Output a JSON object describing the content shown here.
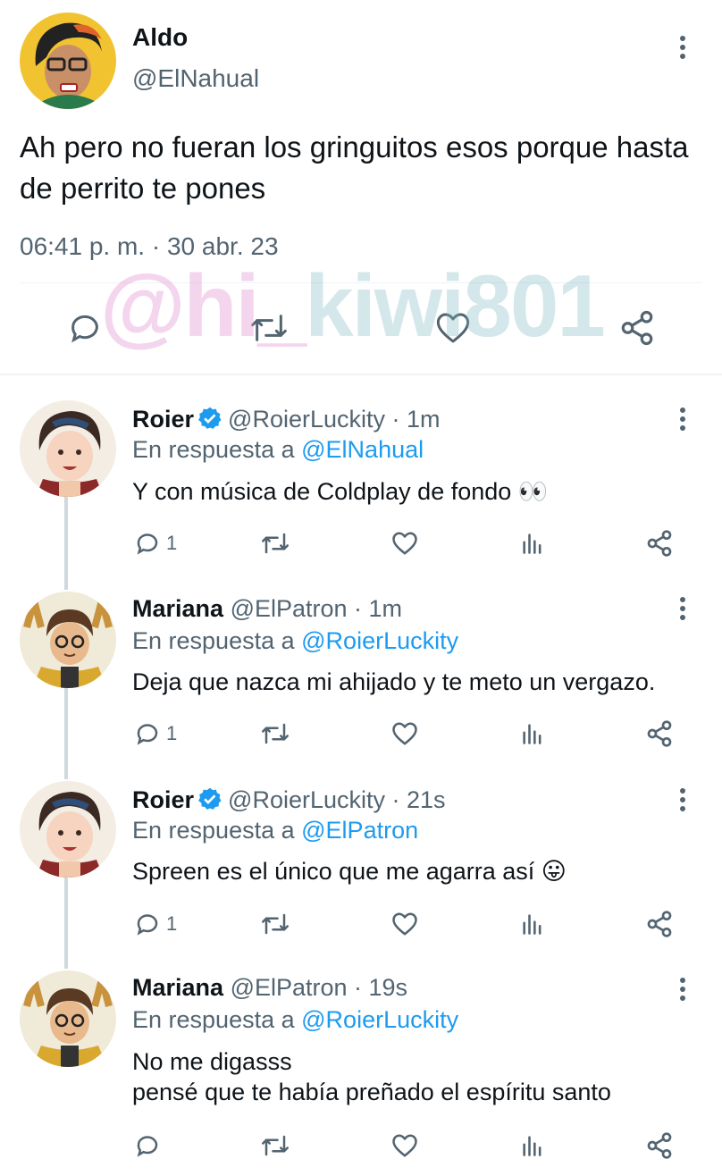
{
  "main_tweet": {
    "name": "Aldo",
    "handle": "@ElNahual",
    "text": "Ah pero no fueran los gringuitos esos porque hasta de perrito te pones",
    "timestamp": "06:41 p. m. · 30 abr. 23",
    "actions": [
      "comment-icon",
      "retweet-icon",
      "like-icon",
      "share-icon"
    ]
  },
  "watermark": {
    "part1": "@hi_",
    "part2": "kiwi801"
  },
  "replies": [
    {
      "name": "Roier",
      "verified": true,
      "handle_time": "@RoierLuckity · 1m",
      "replying_label": "En respuesta a",
      "replying_to": "@ElNahual",
      "text": "Y con música de Coldplay de fondo 👀",
      "reply_count": "1"
    },
    {
      "name": "Mariana",
      "verified": false,
      "handle_time": "@ElPatron · 1m",
      "replying_label": "En respuesta a",
      "replying_to": "@RoierLuckity",
      "text": "Deja que nazca mi ahijado y te meto un vergazo.",
      "reply_count": "1"
    },
    {
      "name": "Roier",
      "verified": true,
      "handle_time": "@RoierLuckity · 21s",
      "replying_label": "En respuesta a",
      "replying_to": "@ElPatron",
      "text": "Spreen es el único que me agarra así 😛",
      "reply_count": "1"
    },
    {
      "name": "Mariana",
      "verified": false,
      "handle_time": "@ElPatron · 19s",
      "replying_label": "En respuesta a",
      "replying_to": "@RoierLuckity",
      "text_line1": "No me digasss",
      "text_line2": "pensé que te había preñado el espíritu santo",
      "reply_count": ""
    }
  ],
  "colors": {
    "text": "#0f1419",
    "secondary": "#536471",
    "link": "#1d9bf0",
    "divider": "#eff3f4"
  }
}
